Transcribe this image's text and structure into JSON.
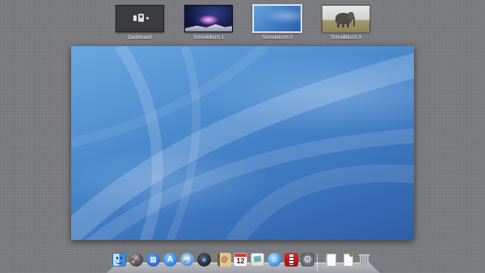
{
  "spaces": [
    {
      "label": "Dashboard",
      "active": false
    },
    {
      "label": "Schreibtisch 1",
      "active": false
    },
    {
      "label": "Schreibtisch 2",
      "active": true
    },
    {
      "label": "Schreibtisch 3",
      "active": false
    }
  ],
  "dock": {
    "items": [
      {
        "name": "finder-icon",
        "glyph": ""
      },
      {
        "name": "launchpad-icon",
        "glyph": "🚀"
      },
      {
        "name": "mission-control-icon",
        "glyph": "▦"
      },
      {
        "name": "app-store-icon",
        "glyph": "A"
      },
      {
        "name": "safari-icon",
        "glyph": ""
      },
      {
        "name": "facetime-icon",
        "glyph": ""
      },
      {
        "name": "address-book-icon",
        "glyph": "@"
      },
      {
        "name": "ical-icon",
        "glyph": ""
      },
      {
        "name": "preview-icon",
        "glyph": ""
      },
      {
        "name": "itunes-icon",
        "glyph": "♫"
      },
      {
        "name": "photo-booth-icon",
        "glyph": ""
      },
      {
        "name": "system-preferences-icon",
        "glyph": "⚙"
      },
      {
        "name": "documents-stack-icon",
        "glyph": ""
      },
      {
        "name": "downloads-stack-icon",
        "glyph": ""
      },
      {
        "name": "trash-icon",
        "glyph": ""
      }
    ],
    "ical_day": "12"
  },
  "colors": {
    "background": "#7b7c80",
    "active_space_border": "#ffffff",
    "desktop_blue": "#4b89cd"
  }
}
